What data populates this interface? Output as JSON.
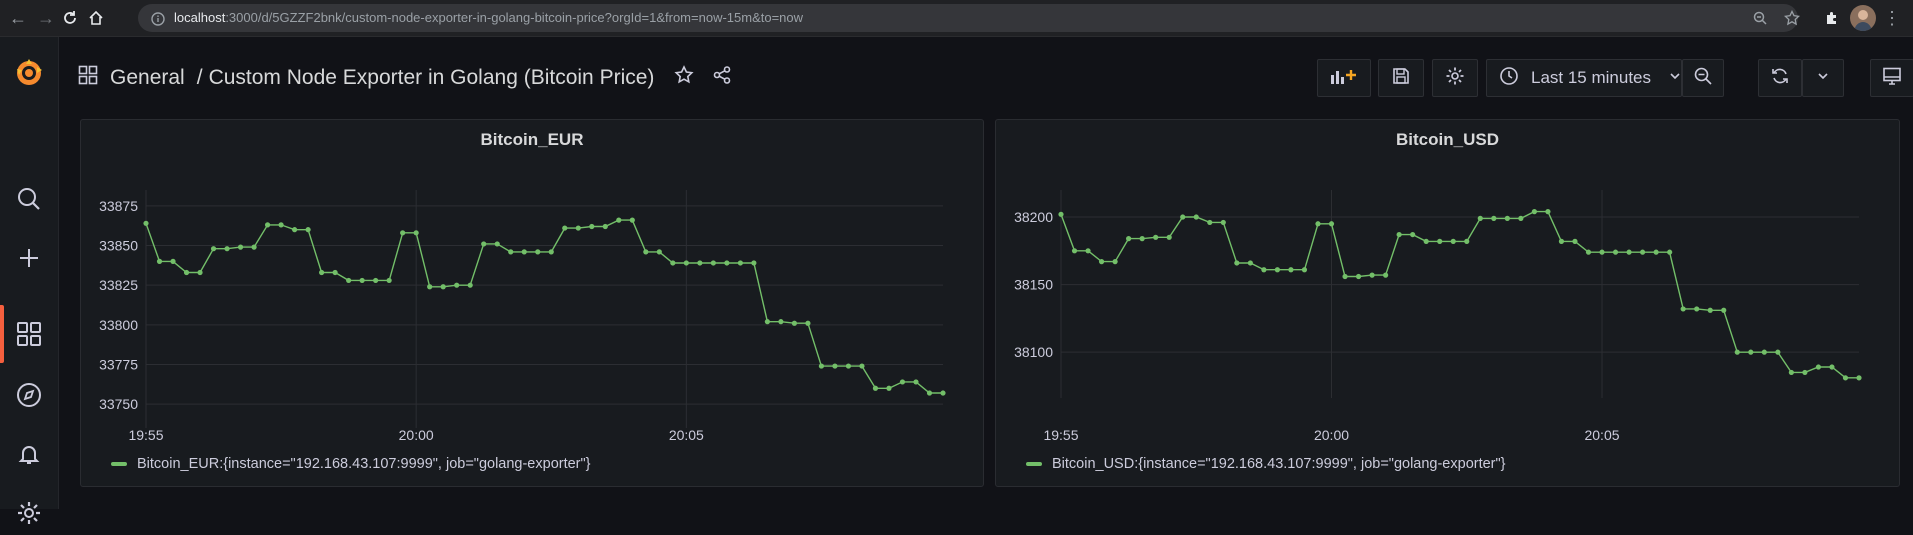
{
  "browser": {
    "url_host": "localhost",
    "url_path": ":3000/d/5GZZF2bnk/custom-node-exporter-in-golang-bitcoin-price?orgId=1&from=now-15m&to=now"
  },
  "header": {
    "folder": "General",
    "separator": "/",
    "dashboard_title": "Custom Node Exporter in Golang (Bitcoin Price)",
    "time_range": "Last 15 minutes"
  },
  "colors": {
    "series": "#73bf69",
    "accent": "#f55f3e",
    "background": "#111217",
    "panel": "#181b1f"
  },
  "chart_data": [
    {
      "type": "line",
      "title": "Bitcoin_EUR",
      "x_tick_labels": [
        "19:55",
        "20:00",
        "20:05"
      ],
      "y_tick_labels": [
        "33875",
        "33850",
        "33825",
        "33800",
        "33775",
        "33750"
      ],
      "ylim": [
        33740,
        33885
      ],
      "grid": true,
      "legend_position": "bottom-left",
      "series": [
        {
          "name": "Bitcoin_EUR:{instance=\"192.168.43.107:9999\", job=\"golang-exporter\"}",
          "values": [
            33864,
            33840,
            33840,
            33833,
            33833,
            33848,
            33848,
            33849,
            33849,
            33863,
            33863,
            33860,
            33860,
            33833,
            33833,
            33828,
            33828,
            33828,
            33828,
            33858,
            33858,
            33824,
            33824,
            33825,
            33825,
            33851,
            33851,
            33846,
            33846,
            33846,
            33846,
            33861,
            33861,
            33862,
            33862,
            33866,
            33866,
            33846,
            33846,
            33839,
            33839,
            33839,
            33839,
            33839,
            33839,
            33839,
            33802,
            33802,
            33801,
            33801,
            33774,
            33774,
            33774,
            33774,
            33760,
            33760,
            33764,
            33764,
            33757,
            33757
          ]
        }
      ]
    },
    {
      "type": "line",
      "title": "Bitcoin_USD",
      "x_tick_labels": [
        "19:55",
        "20:00",
        "20:05"
      ],
      "y_tick_labels": [
        "38200",
        "38150",
        "38100"
      ],
      "ylim": [
        38072,
        38220
      ],
      "grid": true,
      "legend_position": "bottom-left",
      "series": [
        {
          "name": "Bitcoin_USD:{instance=\"192.168.43.107:9999\", job=\"golang-exporter\"}",
          "values": [
            38202,
            38175,
            38175,
            38167,
            38167,
            38184,
            38184,
            38185,
            38185,
            38200,
            38200,
            38196,
            38196,
            38166,
            38166,
            38161,
            38161,
            38161,
            38161,
            38195,
            38195,
            38156,
            38156,
            38157,
            38157,
            38187,
            38187,
            38182,
            38182,
            38182,
            38182,
            38199,
            38199,
            38199,
            38199,
            38204,
            38204,
            38182,
            38182,
            38174,
            38174,
            38174,
            38174,
            38174,
            38174,
            38174,
            38132,
            38132,
            38131,
            38131,
            38100,
            38100,
            38100,
            38100,
            38085,
            38085,
            38089,
            38089,
            38081,
            38081
          ]
        }
      ]
    }
  ]
}
